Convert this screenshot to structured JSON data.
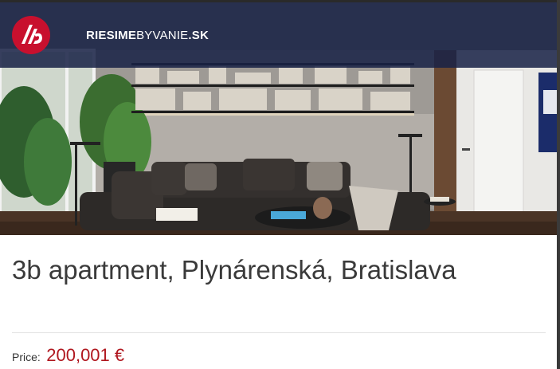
{
  "site": {
    "name_bold": "RIESIME",
    "name_light": "BYVANIE",
    "name_suffix": ".SK"
  },
  "hero": {
    "description_icon": "photo"
  },
  "listing": {
    "title": "3b apartment, Plynárenská, Bratislava",
    "price_label": "Price:",
    "price_value": "200,001 €"
  },
  "colors": {
    "header_bg": "#182246",
    "logo_red": "#c8102e",
    "price": "#b0171f"
  }
}
